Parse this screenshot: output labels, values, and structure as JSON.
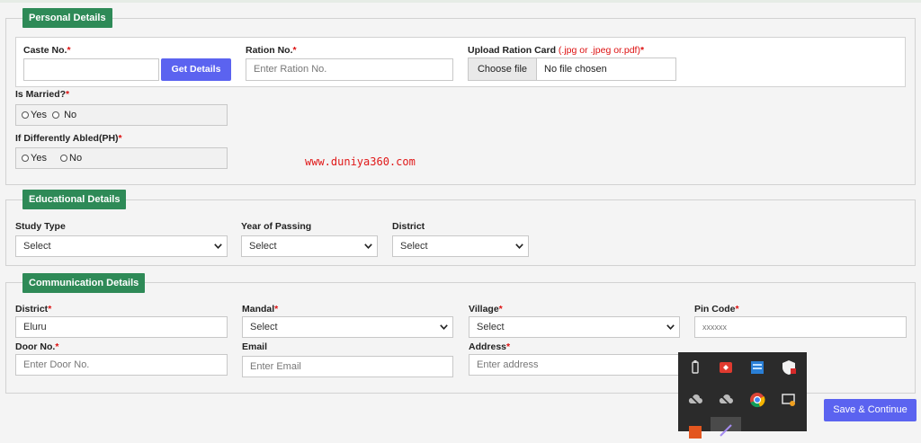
{
  "personal": {
    "legend": "Personal Details",
    "caste_no": {
      "label": "Caste No.",
      "req": "*",
      "value": ""
    },
    "get_details": "Get Details",
    "ration_no": {
      "label": "Ration No.",
      "req": "*",
      "placeholder": "Enter Ration No."
    },
    "upload": {
      "label": "Upload Ration Card ",
      "hint": "(.jpg or .jpeg or.pdf)",
      "req": "*",
      "button": "Choose file",
      "status": "No file chosen"
    },
    "married": {
      "label": "Is Married?",
      "req": "*",
      "opt_yes": "Yes",
      "opt_no": "No"
    },
    "ph": {
      "label": "If Differently Abled(PH)",
      "req": "*",
      "opt_yes": "Yes",
      "opt_no": "No"
    }
  },
  "watermark": "www.duniya360.com",
  "educational": {
    "legend": "Educational Details",
    "study_type": {
      "label": "Study Type",
      "value": "Select"
    },
    "year": {
      "label": "Year of Passing",
      "value": "Select"
    },
    "district": {
      "label": "District",
      "value": "Select"
    }
  },
  "communication": {
    "legend": "Communication Details",
    "district": {
      "label": "District",
      "req": "*",
      "value": "Eluru"
    },
    "mandal": {
      "label": "Mandal",
      "req": "*",
      "value": "Select"
    },
    "village": {
      "label": "Village",
      "req": "*",
      "value": "Select"
    },
    "pin": {
      "label": "Pin Code",
      "req": "*",
      "placeholder": "xxxxxx"
    },
    "door": {
      "label": "Door No.",
      "req": "*",
      "placeholder": "Enter Door No."
    },
    "email": {
      "label": "Email",
      "placeholder": "Enter Email"
    },
    "address": {
      "label": "Address",
      "req": "*",
      "placeholder": "Enter address"
    }
  },
  "save_button": "Save & Continue",
  "tray_icons": [
    "usb-drive-icon",
    "red-app-icon",
    "network-app-icon",
    "security-shield-icon",
    "cloud-offline-icon",
    "cloud-offline-icon",
    "chrome-icon",
    "update-monitor-icon",
    "orange-app-icon",
    "pen-app-icon"
  ],
  "colors": {
    "legend_green": "#2e8a57",
    "primary_blue": "#5b63f0",
    "required_red": "#d11111",
    "watermark_red": "#e01818",
    "tray_bg": "#2b2b2b"
  }
}
